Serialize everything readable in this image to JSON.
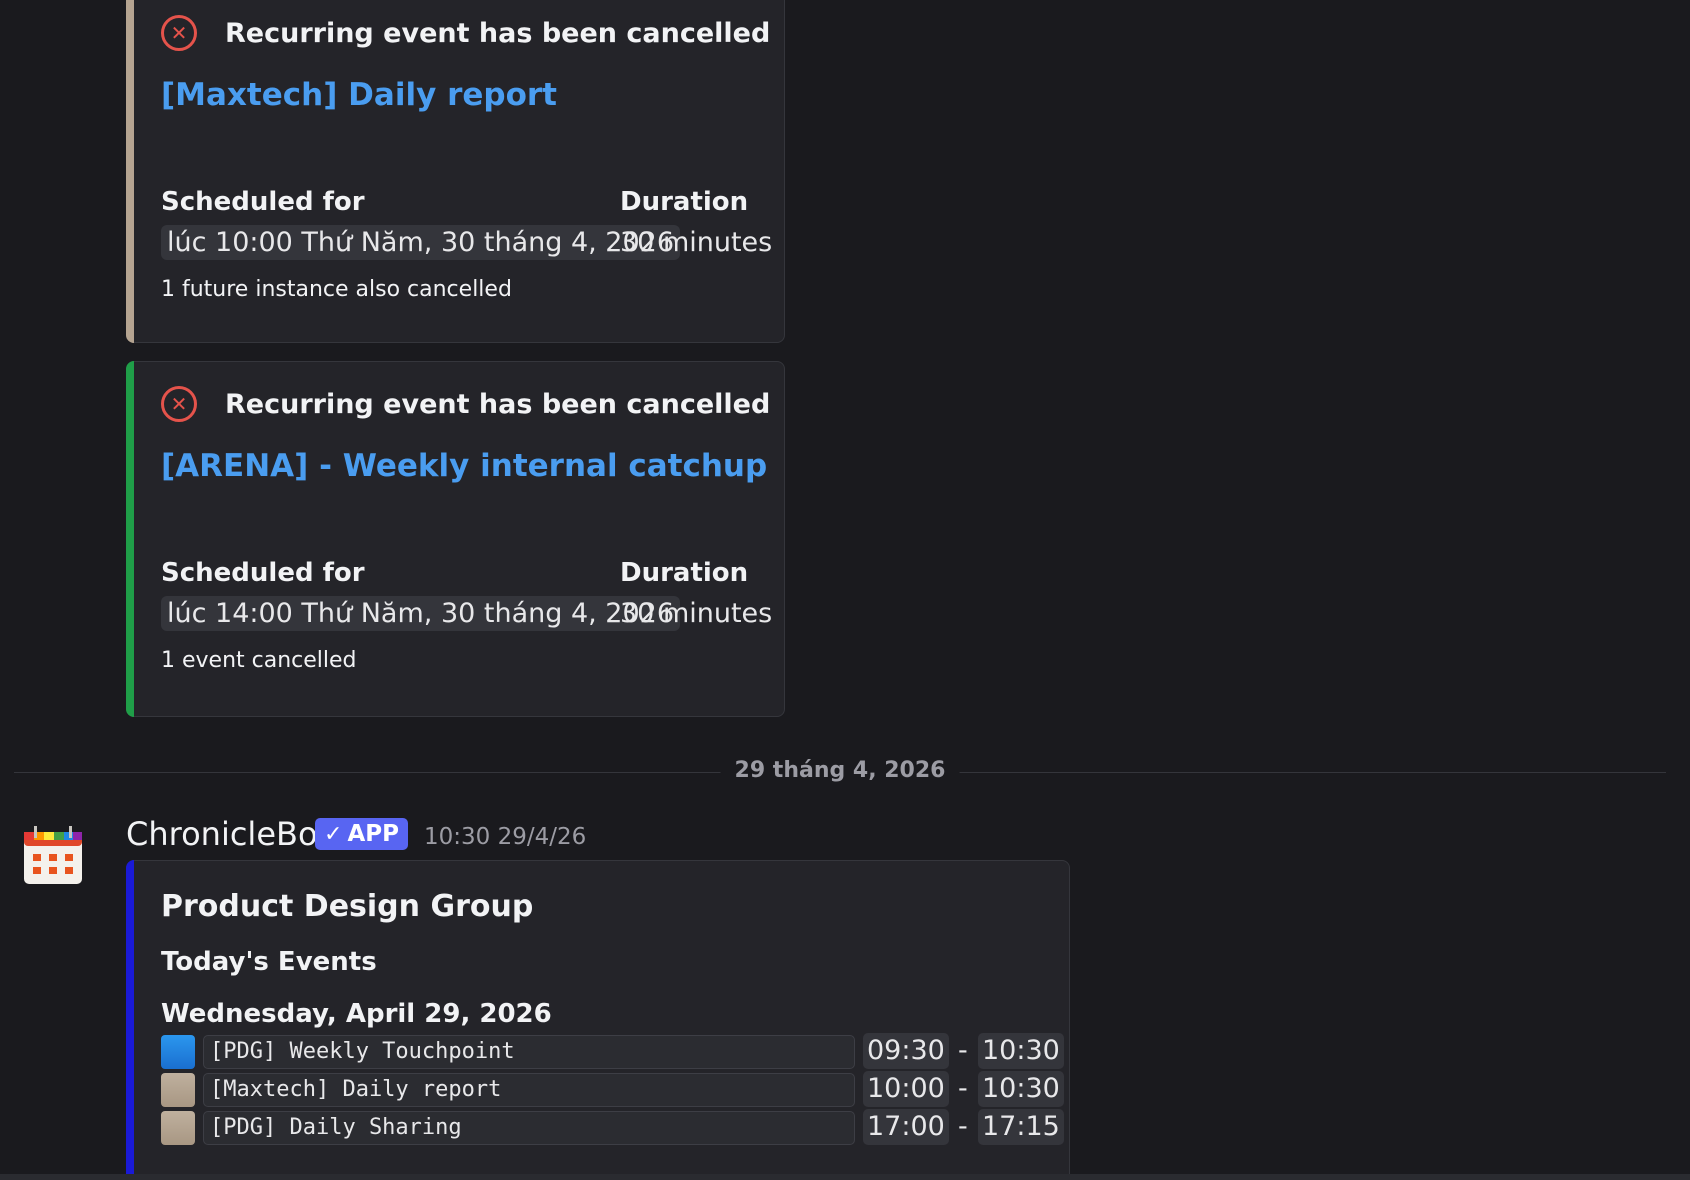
{
  "cancel_cards": [
    {
      "heading": "Recurring event has been cancelled",
      "event_title": "[Maxtech] Daily report",
      "scheduled_label": "Scheduled for",
      "scheduled_value": "lúc 10:00 Thứ Năm, 30 tháng 4, 2026",
      "duration_label": "Duration",
      "duration_value": "30 minutes",
      "note": "1 future instance also cancelled",
      "accent_color": "#b5a491"
    },
    {
      "heading": "Recurring event has been cancelled",
      "event_title": "[ARENA] - Weekly internal catchup",
      "scheduled_label": "Scheduled for",
      "scheduled_value": "lúc 14:00 Thứ Năm, 30 tháng 4, 2026",
      "duration_label": "Duration",
      "duration_value": "30 minutes",
      "note": "1 event cancelled",
      "accent_color": "#1f9e48"
    }
  ],
  "divider": {
    "date": "29 tháng 4, 2026"
  },
  "message": {
    "author": "ChronicleBot",
    "badge": "APP",
    "timestamp": "10:30 29/4/26",
    "avatar_icon": "calendar-icon"
  },
  "agenda": {
    "accent_color": "#1a1ad6",
    "group": "Product Design Group",
    "section": "Today's Events",
    "date": "Wednesday, April 29, 2026",
    "events": [
      {
        "name": "[PDG] Weekly Touchpoint",
        "start": "09:30",
        "end": "10:30",
        "color": "#1e88e5"
      },
      {
        "name": "[Maxtech] Daily report",
        "start": "10:00",
        "end": "10:30",
        "color": "#b5a491"
      },
      {
        "name": "[PDG] Daily Sharing",
        "start": "17:00",
        "end": "17:15",
        "color": "#b5a491"
      }
    ]
  },
  "icons": {
    "cancel": "x-circle-icon",
    "badge_check": "check-icon"
  }
}
